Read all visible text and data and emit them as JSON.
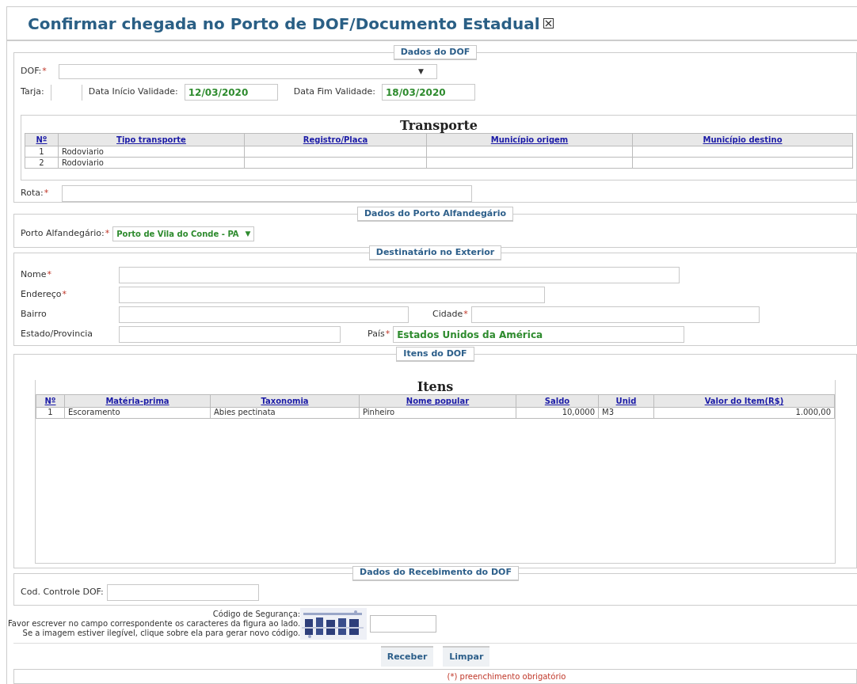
{
  "title": "Confirmar chegada no Porto de DOF/Documento Estadual",
  "dof_section": {
    "legend": "Dados do DOF",
    "dof": {
      "label": "DOF:",
      "required_mark": "*",
      "arrow": "▼"
    },
    "tarja": {
      "label": "Tarja:"
    },
    "inicio": {
      "label": "Data Início Validade:",
      "value": "12/03/2020"
    },
    "fim": {
      "label": "Data Fim Validade:",
      "value": "18/03/2020"
    },
    "transport": {
      "caption": "Transporte",
      "columns": [
        "Nº",
        "Tipo transporte",
        "Registro/Placa",
        "Município origem",
        "Município destino"
      ],
      "rows": [
        [
          "1",
          "Rodoviario",
          "",
          "",
          ""
        ],
        [
          "2",
          "Rodoviario",
          "",
          "",
          ""
        ]
      ]
    },
    "rota": {
      "label": "Rota:",
      "required_mark": "*"
    }
  },
  "porto_section": {
    "legend": "Dados do Porto Alfandegário",
    "label": "Porto Alfandegário:",
    "required_mark": "*",
    "value": "Porto de Vila do Conde - PA",
    "arrow": "▼"
  },
  "dest_section": {
    "legend": "Destinatário no Exterior",
    "nome": {
      "label": "Nome",
      "required_mark": "*"
    },
    "endereco": {
      "label": "Endereço",
      "required_mark": "*"
    },
    "bairro": {
      "label": "Bairro"
    },
    "cidade": {
      "label": "Cidade",
      "required_mark": "*"
    },
    "estado": {
      "label": "Estado/Provincia"
    },
    "pais": {
      "label": "País",
      "required_mark": "*",
      "value": "Estados Unidos da América"
    }
  },
  "itens_section": {
    "legend": "Itens do DOF",
    "caption": "Itens",
    "columns": [
      "Nº",
      "Matéria-prima",
      "Taxonomia",
      "Nome popular",
      "Saldo",
      "Unid",
      "Valor do Item(R$)"
    ],
    "rows": [
      [
        "1",
        "Escoramento",
        "Abies pectinata",
        "Pinheiro",
        "10,0000",
        "M3",
        "1.000,00"
      ]
    ]
  },
  "receb_section": {
    "legend": "Dados do Recebimento do DOF",
    "label": "Cod. Controle DOF:"
  },
  "security": {
    "lines": [
      "Código de Segurança:",
      "Favor escrever no campo correspondente os caracteres da figura ao lado.",
      "Se a imagem estiver ilegível, clique sobre ela para gerar novo código."
    ]
  },
  "buttons": [
    "Receber",
    "Limpar"
  ],
  "footer": "(*) preenchimento obrigatório"
}
